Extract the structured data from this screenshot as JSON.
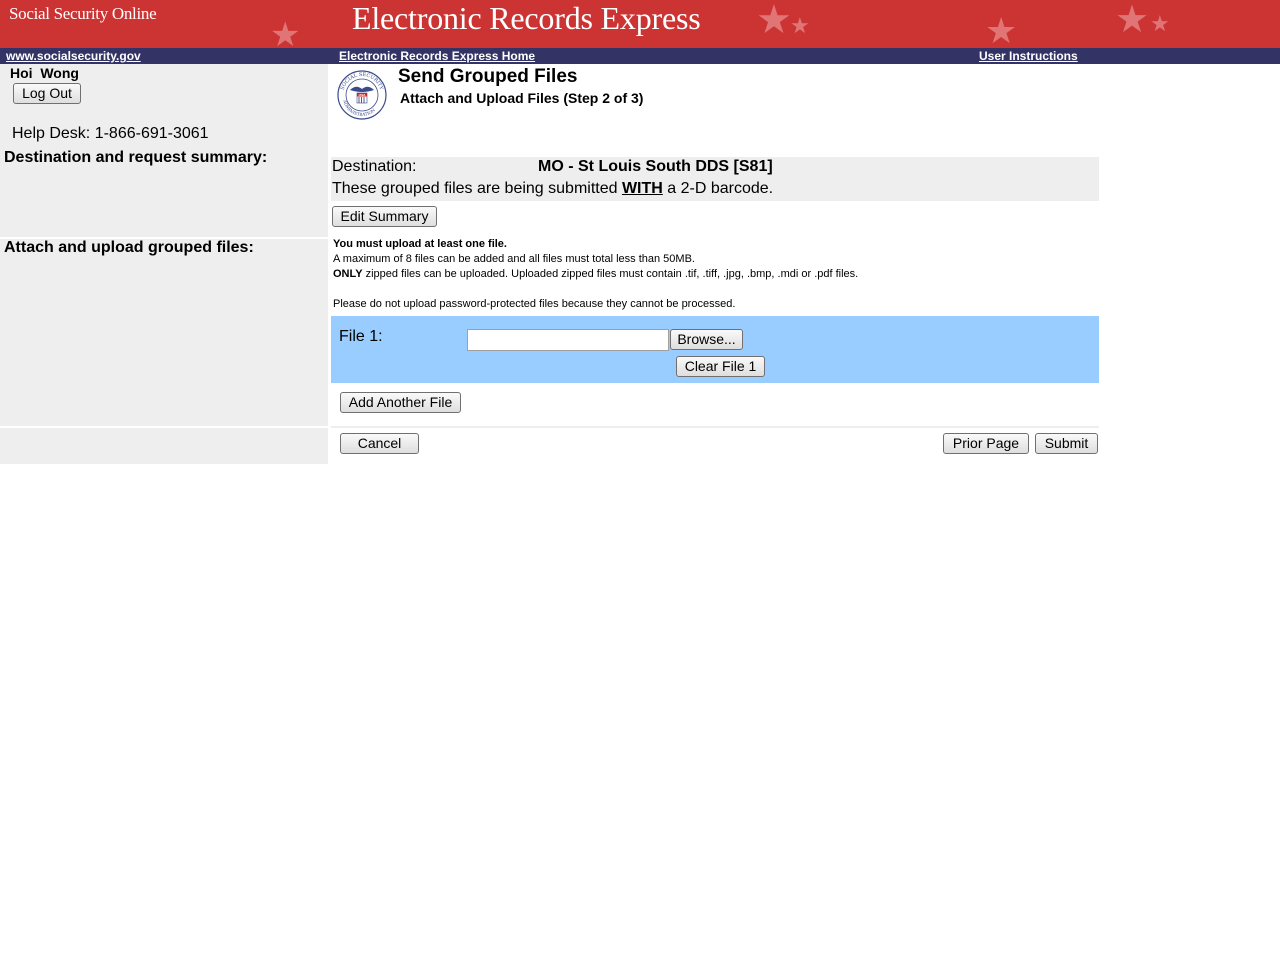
{
  "banner": {
    "brand": "Social Security Online",
    "title": "Electronic Records Express"
  },
  "nav": {
    "site_link": "www.socialsecurity.gov",
    "home_link": "Electronic Records Express Home",
    "instructions_link": "User Instructions"
  },
  "sidebar": {
    "user_name": "Hoi  Wong",
    "logout_label": "Log Out",
    "helpdesk": "Help Desk: 1-866-691-3061",
    "section_summary": "Destination and request summary:",
    "section_upload": "Attach and upload grouped files:"
  },
  "page": {
    "title": "Send Grouped Files",
    "subtitle": "Attach and Upload Files (Step 2 of 3)"
  },
  "summary": {
    "destination_label": "Destination:",
    "destination_value": "MO - St Louis South DDS [S81]",
    "barcode_prefix": "These grouped files are being submitted ",
    "barcode_emphasis": "WITH",
    "barcode_suffix": " a 2-D barcode.",
    "edit_button": "Edit Summary"
  },
  "instructions": {
    "line1": "You must upload at least one file.",
    "line2": "A maximum of 8 files can be added and all files must total less than 50MB.",
    "line3_bold": "ONLY",
    "line3_rest": " zipped files can be uploaded. Uploaded zipped files must contain .tif, .tiff, .jpg, .bmp, .mdi or .pdf files.",
    "line4": "Please do not upload password-protected files because they cannot be processed."
  },
  "upload": {
    "file1_label": "File 1:",
    "file1_value": "",
    "browse_button": "Browse...",
    "clear_button": "Clear File 1",
    "add_button": "Add Another File"
  },
  "actions": {
    "cancel": "Cancel",
    "prior": "Prior Page",
    "submit": "Submit"
  },
  "colors": {
    "banner": "#cc3333",
    "navbar": "#333366",
    "sidebar": "#eeeeee",
    "file_panel": "#99ccff"
  },
  "logo": {
    "text_top": "SOCIAL SECURITY",
    "text_bottom": "ADMINISTRATION",
    "text_center": "USA"
  }
}
